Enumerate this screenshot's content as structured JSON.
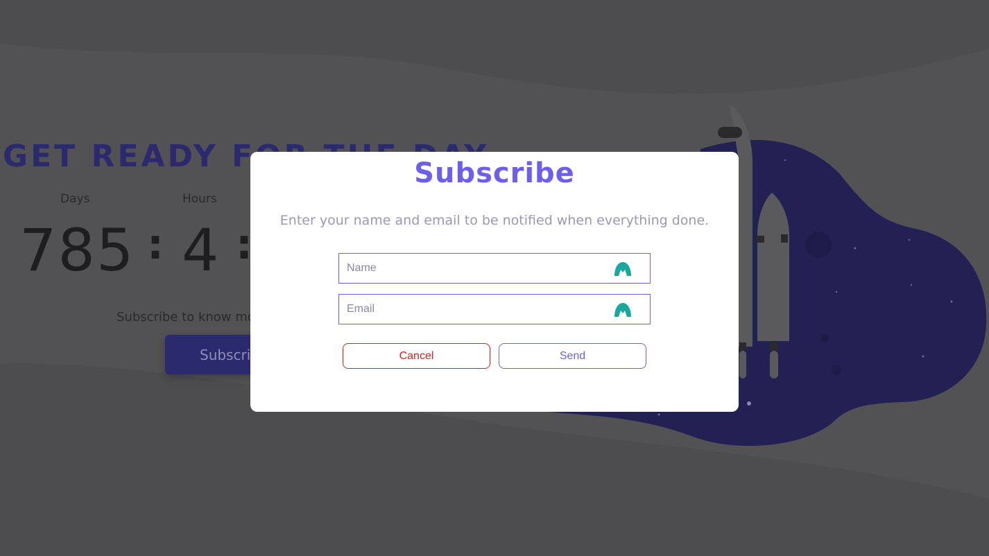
{
  "background": {
    "headline": "GET READY FOR THE DAY",
    "countdown": {
      "days_label": "Days",
      "hours_label": "Hours",
      "days_value": "785",
      "hours_value": "4",
      "separator": ":"
    },
    "subtext": "Subscribe to know mo",
    "subscribe_button_label": "Subscri"
  },
  "modal": {
    "title": "Subscribe",
    "description": "Enter your name and email to be notified when everything done.",
    "name_field": {
      "placeholder": "Name",
      "value": "",
      "icon": "autofill-icon"
    },
    "email_field": {
      "placeholder": "Email",
      "value": "",
      "icon": "autofill-icon"
    },
    "cancel_label": "Cancel",
    "send_label": "Send"
  },
  "colors": {
    "overlay_bg": "#4d4d4f",
    "accent": "#6c5ff0",
    "cancel": "#e61b1b",
    "navy": "#2b2a6e",
    "icon_teal": "#18a89e"
  }
}
